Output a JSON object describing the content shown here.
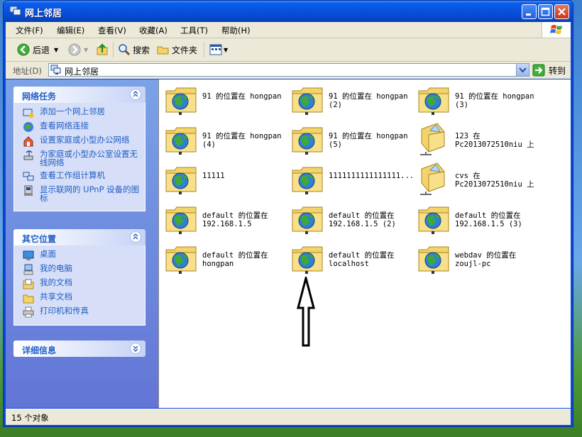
{
  "window": {
    "title": "网上邻居"
  },
  "menu": [
    "文件(F)",
    "编辑(E)",
    "查看(V)",
    "收藏(A)",
    "工具(T)",
    "帮助(H)"
  ],
  "toolbar": {
    "back": "后退",
    "search": "搜索",
    "folders": "文件夹"
  },
  "address": {
    "label": "地址(D)",
    "value": "网上邻居",
    "go": "转到"
  },
  "tasks": {
    "network": {
      "title": "网络任务",
      "items": [
        "添加一个网上邻居",
        "查看网络连接",
        "设置家庭或小型办公网络",
        "为家庭或小型办公室设置无线网络",
        "查看工作组计算机",
        "显示联网的 UPnP 设备的图标"
      ]
    },
    "other": {
      "title": "其它位置",
      "items": [
        "桌面",
        "我的电脑",
        "我的文档",
        "共享文档",
        "打印机和传真"
      ]
    },
    "details": {
      "title": "详细信息"
    }
  },
  "files": [
    {
      "label": "91 的位置在 hongpan",
      "type": "netfolder"
    },
    {
      "label": "91 的位置在 hongpan (2)",
      "type": "netfolder"
    },
    {
      "label": "91 的位置在 hongpan (3)",
      "type": "netfolder"
    },
    {
      "label": "91 的位置在 hongpan (4)",
      "type": "netfolder"
    },
    {
      "label": "91 的位置在 hongpan (5)",
      "type": "netfolder"
    },
    {
      "label": "123 在 Pc2013072510niu 上",
      "type": "share"
    },
    {
      "label": "11111",
      "type": "netfolder"
    },
    {
      "label": "1111111111111111...",
      "type": "netfolder"
    },
    {
      "label": "cvs 在 Pc2013072510niu 上",
      "type": "share"
    },
    {
      "label": "default 的位置在 192.168.1.5",
      "type": "netfolder"
    },
    {
      "label": "default 的位置在 192.168.1.5 (2)",
      "type": "netfolder"
    },
    {
      "label": "default 的位置在 192.168.1.5 (3)",
      "type": "netfolder"
    },
    {
      "label": "default 的位置在 hongpan",
      "type": "netfolder"
    },
    {
      "label": "default 的位置在 localhost",
      "type": "netfolder"
    },
    {
      "label": "webdav 的位置在 zoujl-pc",
      "type": "netfolder"
    }
  ],
  "status": {
    "text": "15 个对象"
  }
}
